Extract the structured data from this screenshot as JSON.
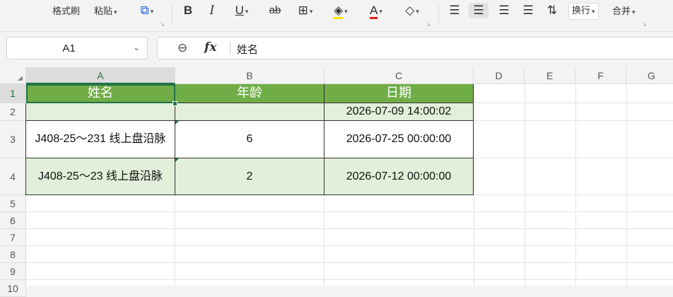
{
  "toolbar": {
    "format_painter": "格式刷",
    "paste": "粘贴",
    "wrap_text": "换行",
    "merge": "合并"
  },
  "formula_bar": {
    "name_box": "A1",
    "content": "姓名"
  },
  "columns": [
    "A",
    "B",
    "C",
    "D",
    "E",
    "F",
    "G"
  ],
  "rows": [
    "1",
    "2",
    "3",
    "4",
    "5",
    "6",
    "7",
    "8",
    "9",
    "10"
  ],
  "sheet": {
    "header": [
      "姓名",
      "年龄",
      "日期"
    ],
    "row2": [
      "",
      "",
      "2026-07-09 14:00:02"
    ],
    "row3": [
      "J408-25～231 线上盘沿脉",
      "6",
      "2026-07-25 00:00:00"
    ],
    "row4": [
      "J408-25～23 线上盘沿脉",
      "2",
      "2026-07-12 00:00:00"
    ]
  },
  "colors": {
    "header_fill": "#70ad47",
    "band_fill": "#e2efda",
    "selection": "#217346"
  }
}
